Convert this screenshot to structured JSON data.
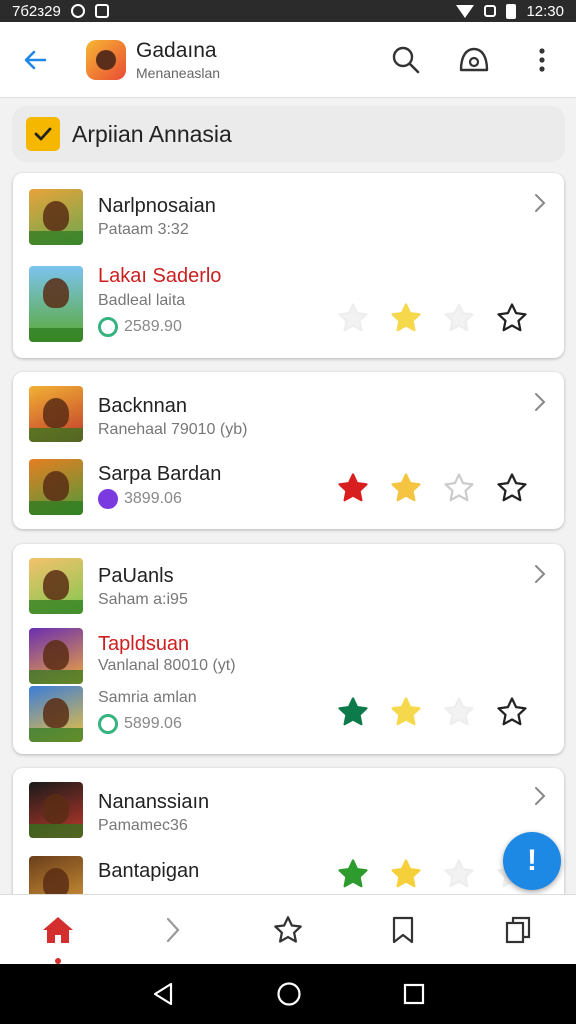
{
  "status_bar": {
    "time_left": "7б2з29",
    "time_right": "12:30"
  },
  "app": {
    "title": "Gadaına",
    "subtitle": "Menaneaslan"
  },
  "filter": {
    "label": "Arpiian Annasia",
    "checked": true
  },
  "cards": [
    {
      "title": "Narlpnosaian",
      "subtitle": "Pataam 3:32",
      "item_title": "Lakaı Saderlo",
      "item_subtitle": "Badleal laita",
      "price": "2589.90",
      "stars": [
        {
          "color": "#f2f2f2",
          "filled": true
        },
        {
          "color": "#f5d84b",
          "filled": true
        },
        {
          "color": "#f2f2f2",
          "filled": true
        },
        {
          "color": "#222222",
          "filled": false
        }
      ]
    },
    {
      "title": "Backnnan",
      "subtitle": "Ranehaal 79010 (yb)",
      "item_title": "Sarpa Bardan",
      "price": "3899.06",
      "stars": [
        {
          "color": "#d81f1f",
          "filled": true
        },
        {
          "color": "#f5c542",
          "filled": true
        },
        {
          "color": "#cccccc",
          "filled": false
        },
        {
          "color": "#222222",
          "filled": false
        }
      ]
    },
    {
      "title": "PaUanls",
      "subtitle": "Saham a:i95",
      "item_title": "Tapldsuan",
      "item_subtitle": "Vanlanal 80010 (yt)",
      "extra_title": "Samria amlan",
      "price": "5899.06",
      "stars": [
        {
          "color": "#0c7a4a",
          "filled": true
        },
        {
          "color": "#f5d84b",
          "filled": true
        },
        {
          "color": "#f2f2f2",
          "filled": true
        },
        {
          "color": "#222222",
          "filled": false
        }
      ]
    },
    {
      "title": "Nananssiaın",
      "subtitle": "Pamamec36",
      "item_title": "Bantapigan",
      "stars": [
        {
          "color": "#2e9b2e",
          "filled": true
        },
        {
          "color": "#f5d03b",
          "filled": true
        },
        {
          "color": "#f2f2f2",
          "filled": true
        },
        {
          "color": "#f2f2f2",
          "filled": true
        }
      ]
    }
  ],
  "fab": {
    "label": "!"
  },
  "colors": {
    "accent": "#1e88e5",
    "nav_active": "#d32f2f",
    "checkbox": "#f5b700"
  },
  "bottom_nav": [
    "home-icon",
    "chevron-right-icon",
    "star-icon",
    "bookmark-icon",
    "copy-icon"
  ]
}
